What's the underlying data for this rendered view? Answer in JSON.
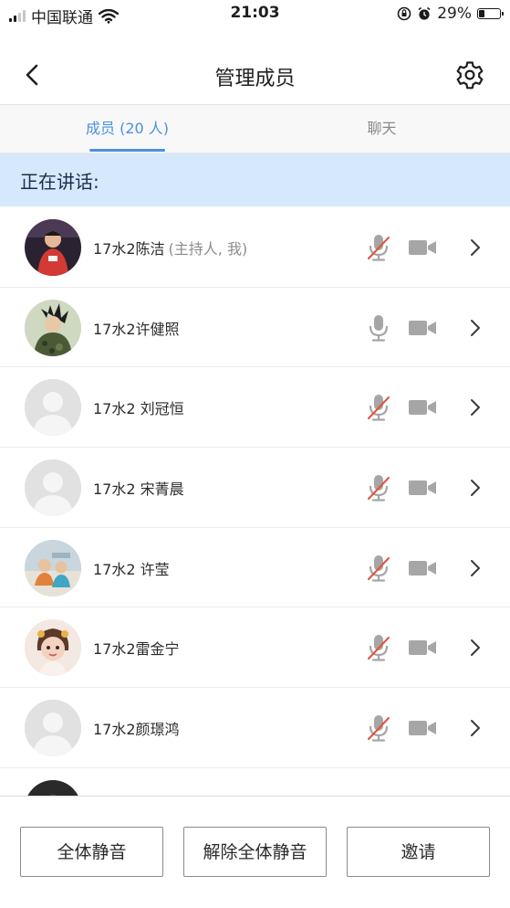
{
  "status_bar": {
    "carrier": "中国联通",
    "time": "21:03",
    "battery_percent": "29%",
    "battery_level": 0.29,
    "icons": [
      "signal-icon",
      "wifi-icon",
      "orientation-lock-icon",
      "alarm-icon",
      "battery-icon"
    ]
  },
  "nav": {
    "title": "管理成员",
    "back_icon": "back-chevron-icon",
    "settings_icon": "gear-icon"
  },
  "tabs": [
    {
      "label": "成员 (20 人)",
      "active": true
    },
    {
      "label": "聊天",
      "active": false
    }
  ],
  "speaking_label": "正在讲话:",
  "members": [
    {
      "name": "17水2陈洁",
      "tag": "(主持人, 我)",
      "avatar": "photo-red-shirt",
      "mic_muted": true
    },
    {
      "name": "17水2许健照",
      "tag": "",
      "avatar": "photo-cartoon",
      "mic_muted": false
    },
    {
      "name": "17水2 刘冠恒",
      "tag": "",
      "avatar": "default",
      "mic_muted": true
    },
    {
      "name": "17水2 宋菁晨",
      "tag": "",
      "avatar": "default",
      "mic_muted": true
    },
    {
      "name": "17水2 许莹",
      "tag": "",
      "avatar": "photo-group",
      "mic_muted": true
    },
    {
      "name": "17水2雷金宁",
      "tag": "",
      "avatar": "photo-child",
      "mic_muted": true
    },
    {
      "name": "17水2颜璟鸿",
      "tag": "",
      "avatar": "default",
      "mic_muted": true
    },
    {
      "name": "",
      "tag": "",
      "avatar": "photo-dark",
      "mic_muted": true
    }
  ],
  "bottom_buttons": {
    "mute_all": "全体静音",
    "unmute_all": "解除全体静音",
    "invite": "邀请"
  },
  "colors": {
    "accent": "#4a90e2",
    "speaking_bg": "#d6e8fb",
    "muted_slash": "#e0533b",
    "icon_gray": "#a6a6a6"
  }
}
